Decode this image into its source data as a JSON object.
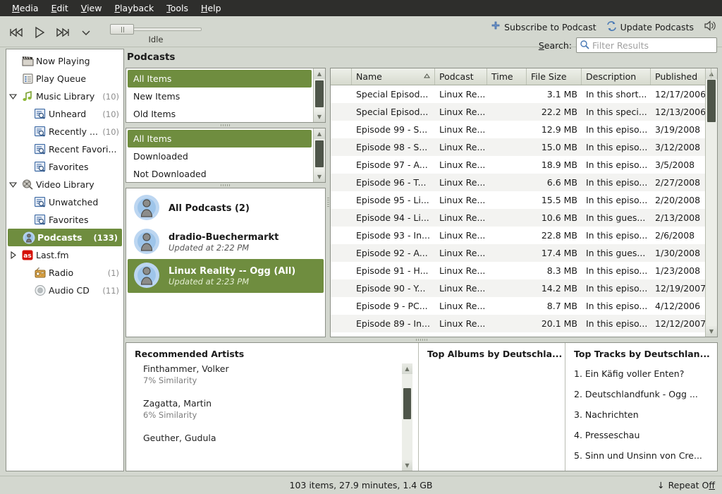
{
  "menubar": {
    "items": [
      {
        "pre": "M",
        "rest": "edia"
      },
      {
        "pre": "E",
        "rest": "dit"
      },
      {
        "pre": "V",
        "rest": "iew"
      },
      {
        "pre": "P",
        "rest": "layback"
      },
      {
        "pre": "T",
        "rest": "ools"
      },
      {
        "pre": "H",
        "rest": "elp"
      }
    ]
  },
  "toolbar": {
    "previous_label": "Previous",
    "play_label": "Play",
    "next_label": "Next",
    "menu_label": "Playback menu",
    "seek_status": "Idle",
    "subscribe_label": "Subscribe to Podcast",
    "update_label": "Update Podcasts",
    "volume_label": "Volume",
    "search_label_pre": "S",
    "search_label_rest": "earch:",
    "search_value": "",
    "search_placeholder": "Filter Results"
  },
  "sidebar": {
    "items": [
      {
        "label": "Now Playing",
        "count": "",
        "icon": "clapperboard-icon",
        "depth": 0,
        "expander": "",
        "selected": false
      },
      {
        "label": "Play Queue",
        "count": "",
        "icon": "queue-icon",
        "depth": 0,
        "expander": "",
        "selected": false
      },
      {
        "label": "Music Library",
        "count": "(10)",
        "icon": "music-note-icon",
        "depth": 0,
        "expander": "down",
        "selected": false
      },
      {
        "label": "Unheard",
        "count": "(10)",
        "icon": "smart-playlist-icon",
        "depth": 1,
        "expander": "",
        "selected": false
      },
      {
        "label": "Recently ...",
        "count": "(10)",
        "icon": "smart-playlist-icon",
        "depth": 1,
        "expander": "",
        "selected": false
      },
      {
        "label": "Recent Favori...",
        "count": "",
        "icon": "smart-playlist-icon",
        "depth": 1,
        "expander": "",
        "selected": false
      },
      {
        "label": "Favorites",
        "count": "",
        "icon": "smart-playlist-icon",
        "depth": 1,
        "expander": "",
        "selected": false
      },
      {
        "label": "Video Library",
        "count": "",
        "icon": "video-reel-icon",
        "depth": 0,
        "expander": "down",
        "selected": false
      },
      {
        "label": "Unwatched",
        "count": "",
        "icon": "smart-playlist-icon",
        "depth": 1,
        "expander": "",
        "selected": false
      },
      {
        "label": "Favorites",
        "count": "",
        "icon": "smart-playlist-icon",
        "depth": 1,
        "expander": "",
        "selected": false
      },
      {
        "label": "Podcasts",
        "count": "(133)",
        "icon": "podcast-icon",
        "depth": 0,
        "expander": "",
        "selected": true
      },
      {
        "label": "Last.fm",
        "count": "",
        "icon": "lastfm-icon",
        "depth": 0,
        "expander": "right",
        "selected": false
      },
      {
        "label": "Radio",
        "count": "(1)",
        "icon": "radio-icon",
        "depth": 1,
        "expander": "",
        "selected": false
      },
      {
        "label": "Audio CD",
        "count": "(11)",
        "icon": "cd-icon",
        "depth": 1,
        "expander": "",
        "selected": false
      }
    ]
  },
  "view": {
    "title": "Podcasts"
  },
  "filters": {
    "pane1": [
      {
        "label": "All Items",
        "selected": true
      },
      {
        "label": "New Items",
        "selected": false
      },
      {
        "label": "Old Items",
        "selected": false
      }
    ],
    "pane2": [
      {
        "label": "All Items",
        "selected": true
      },
      {
        "label": "Downloaded",
        "selected": false
      },
      {
        "label": "Not Downloaded",
        "selected": false
      }
    ],
    "sources": [
      {
        "title": "All Podcasts (2)",
        "sub": "",
        "selected": false
      },
      {
        "title": "dradio-Buechermarkt",
        "sub": "Updated at 2:22 PM",
        "selected": false
      },
      {
        "title": "Linux Reality -- Ogg (All)",
        "sub": "Updated at 2:23 PM",
        "selected": true
      }
    ]
  },
  "tracklist": {
    "columns": [
      "",
      "Name",
      "Podcast",
      "Time",
      "File Size",
      "Description",
      "Published"
    ],
    "sort_column": "Name",
    "sort_direction": "ascending",
    "rows": [
      {
        "name": "Special Episod...",
        "podcast": "Linux Re...",
        "time": "",
        "size": "3.1 MB",
        "desc": "In this short...",
        "published": "12/17/2006"
      },
      {
        "name": "Special Episod...",
        "podcast": "Linux Re...",
        "time": "",
        "size": "22.2 MB",
        "desc": "In this speci...",
        "published": "12/13/2006"
      },
      {
        "name": "Episode 99 - S...",
        "podcast": "Linux Re...",
        "time": "",
        "size": "12.9 MB",
        "desc": "In this episo...",
        "published": "3/19/2008"
      },
      {
        "name": "Episode 98 - S...",
        "podcast": "Linux Re...",
        "time": "",
        "size": "15.0 MB",
        "desc": "In this episo...",
        "published": "3/12/2008"
      },
      {
        "name": "Episode 97 - A...",
        "podcast": "Linux Re...",
        "time": "",
        "size": "18.9 MB",
        "desc": "In this episo...",
        "published": "3/5/2008"
      },
      {
        "name": "Episode 96 - T...",
        "podcast": "Linux Re...",
        "time": "",
        "size": "6.6 MB",
        "desc": "In this episo...",
        "published": "2/27/2008"
      },
      {
        "name": "Episode 95 - Li...",
        "podcast": "Linux Re...",
        "time": "",
        "size": "15.5 MB",
        "desc": "In this episo...",
        "published": "2/20/2008"
      },
      {
        "name": "Episode 94 - Li...",
        "podcast": "Linux Re...",
        "time": "",
        "size": "10.6 MB",
        "desc": "In this gues...",
        "published": "2/13/2008"
      },
      {
        "name": "Episode 93 - In...",
        "podcast": "Linux Re...",
        "time": "",
        "size": "22.8 MB",
        "desc": "In this episo...",
        "published": "2/6/2008"
      },
      {
        "name": "Episode 92 - A...",
        "podcast": "Linux Re...",
        "time": "",
        "size": "17.4 MB",
        "desc": "In this gues...",
        "published": "1/30/2008"
      },
      {
        "name": "Episode 91 - H...",
        "podcast": "Linux Re...",
        "time": "",
        "size": "8.3 MB",
        "desc": "In this episo...",
        "published": "1/23/2008"
      },
      {
        "name": "Episode 90 - Y...",
        "podcast": "Linux Re...",
        "time": "",
        "size": "14.2 MB",
        "desc": "In this episo...",
        "published": "12/19/2007"
      },
      {
        "name": "Episode 9 - PC...",
        "podcast": "Linux Re...",
        "time": "",
        "size": "8.7 MB",
        "desc": "In this episo...",
        "published": "4/12/2006"
      },
      {
        "name": "Episode 89 - In...",
        "podcast": "Linux Re...",
        "time": "",
        "size": "20.1 MB",
        "desc": "In this episo...",
        "published": "12/12/2007"
      }
    ]
  },
  "context_panes": {
    "recommended": {
      "title": "Recommended Artists",
      "artists": [
        {
          "name": "Finthammer, Volker",
          "similarity": "7% Similarity"
        },
        {
          "name": "Zagatta, Martin",
          "similarity": "6% Similarity"
        },
        {
          "name": "Geuther, Gudula",
          "similarity": ""
        }
      ]
    },
    "top_albums": {
      "title": "Top Albums by Deutschla...",
      "items": []
    },
    "top_tracks": {
      "title": "Top Tracks by Deutschlan...",
      "items": [
        "1. Ein Käfig voller Enten?",
        "2. Deutschlandfunk - Ogg ...",
        "3. Nachrichten",
        "4. Presseschau",
        "5. Sinn und Unsinn von Cre..."
      ]
    }
  },
  "statusbar": {
    "summary": "103 items, 27.9 minutes, 1.4 GB",
    "repeat_pre": "Repeat O",
    "repeat_key": "ff"
  },
  "colors": {
    "selection_green": "#6f8d3f",
    "chrome": "#d3d7cf",
    "menubar": "#2e2e2c"
  }
}
